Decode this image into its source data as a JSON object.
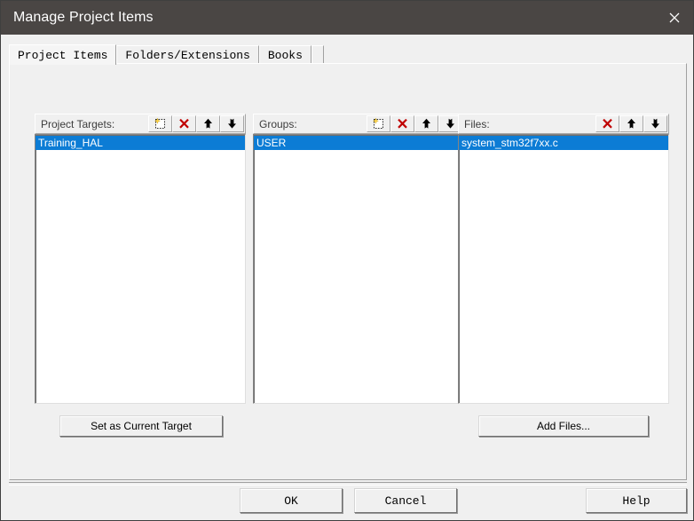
{
  "window": {
    "title": "Manage Project Items",
    "close_label": "×",
    "close_icon": "close-icon"
  },
  "tabs": [
    {
      "label": "Project Items",
      "active": true
    },
    {
      "label": "Folders/Extensions",
      "active": false
    },
    {
      "label": "Books",
      "active": false
    }
  ],
  "columns": [
    {
      "id": "targets",
      "header": "Project Targets:",
      "tools": [
        "new-item-icon",
        "delete-icon",
        "move-up-icon",
        "move-down-icon"
      ],
      "items": [
        {
          "label": "Training_HAL",
          "selected": true
        }
      ]
    },
    {
      "id": "groups",
      "header": "Groups:",
      "tools": [
        "new-item-icon",
        "delete-icon",
        "move-up-icon",
        "move-down-icon"
      ],
      "items": [
        {
          "label": "USER",
          "selected": true
        }
      ]
    },
    {
      "id": "files",
      "header": "Files:",
      "tools": [
        "delete-icon",
        "move-up-icon",
        "move-down-icon"
      ],
      "items": [
        {
          "label": "system_stm32f7xx.c",
          "selected": true
        }
      ]
    }
  ],
  "actions": {
    "set_as_current_target": "Set as Current Target",
    "add_files": "Add Files..."
  },
  "dialog_buttons": {
    "ok": "OK",
    "cancel": "Cancel",
    "help": "Help"
  },
  "colors": {
    "titlebar": "#4a4644",
    "selection": "#0c7cd5",
    "dialog_face": "#f0f0f0",
    "delete_icon": "#c00000",
    "new_item_star": "#ffd24a"
  }
}
